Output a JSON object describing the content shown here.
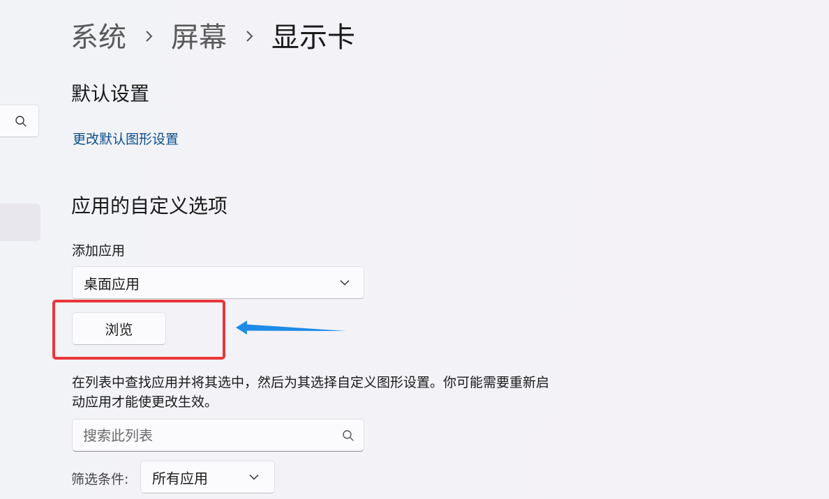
{
  "breadcrumb": {
    "items": [
      "系统",
      "屏幕",
      "显示卡"
    ]
  },
  "sections": {
    "default_title": "默认设置",
    "default_link": "更改默认图形设置",
    "custom_title": "应用的自定义选项"
  },
  "add_app": {
    "label": "添加应用",
    "selected": "桌面应用",
    "browse_label": "浏览"
  },
  "description": "在列表中查找应用并将其选中，然后为其选择自定义图形设置。你可能需要重新启动应用才能使更改生效。",
  "search": {
    "placeholder": "搜索此列表"
  },
  "filter": {
    "label": "筛选条件:",
    "selected": "所有应用"
  },
  "colors": {
    "highlight": "#e8373c",
    "arrow": "#1e8be6",
    "link": "#0b4d8c"
  },
  "icons": {
    "sidebar_search": "search-icon",
    "dropdown": "chevron-down-icon",
    "search": "search-icon",
    "breadcrumb_separator": "chevron-right-icon"
  }
}
